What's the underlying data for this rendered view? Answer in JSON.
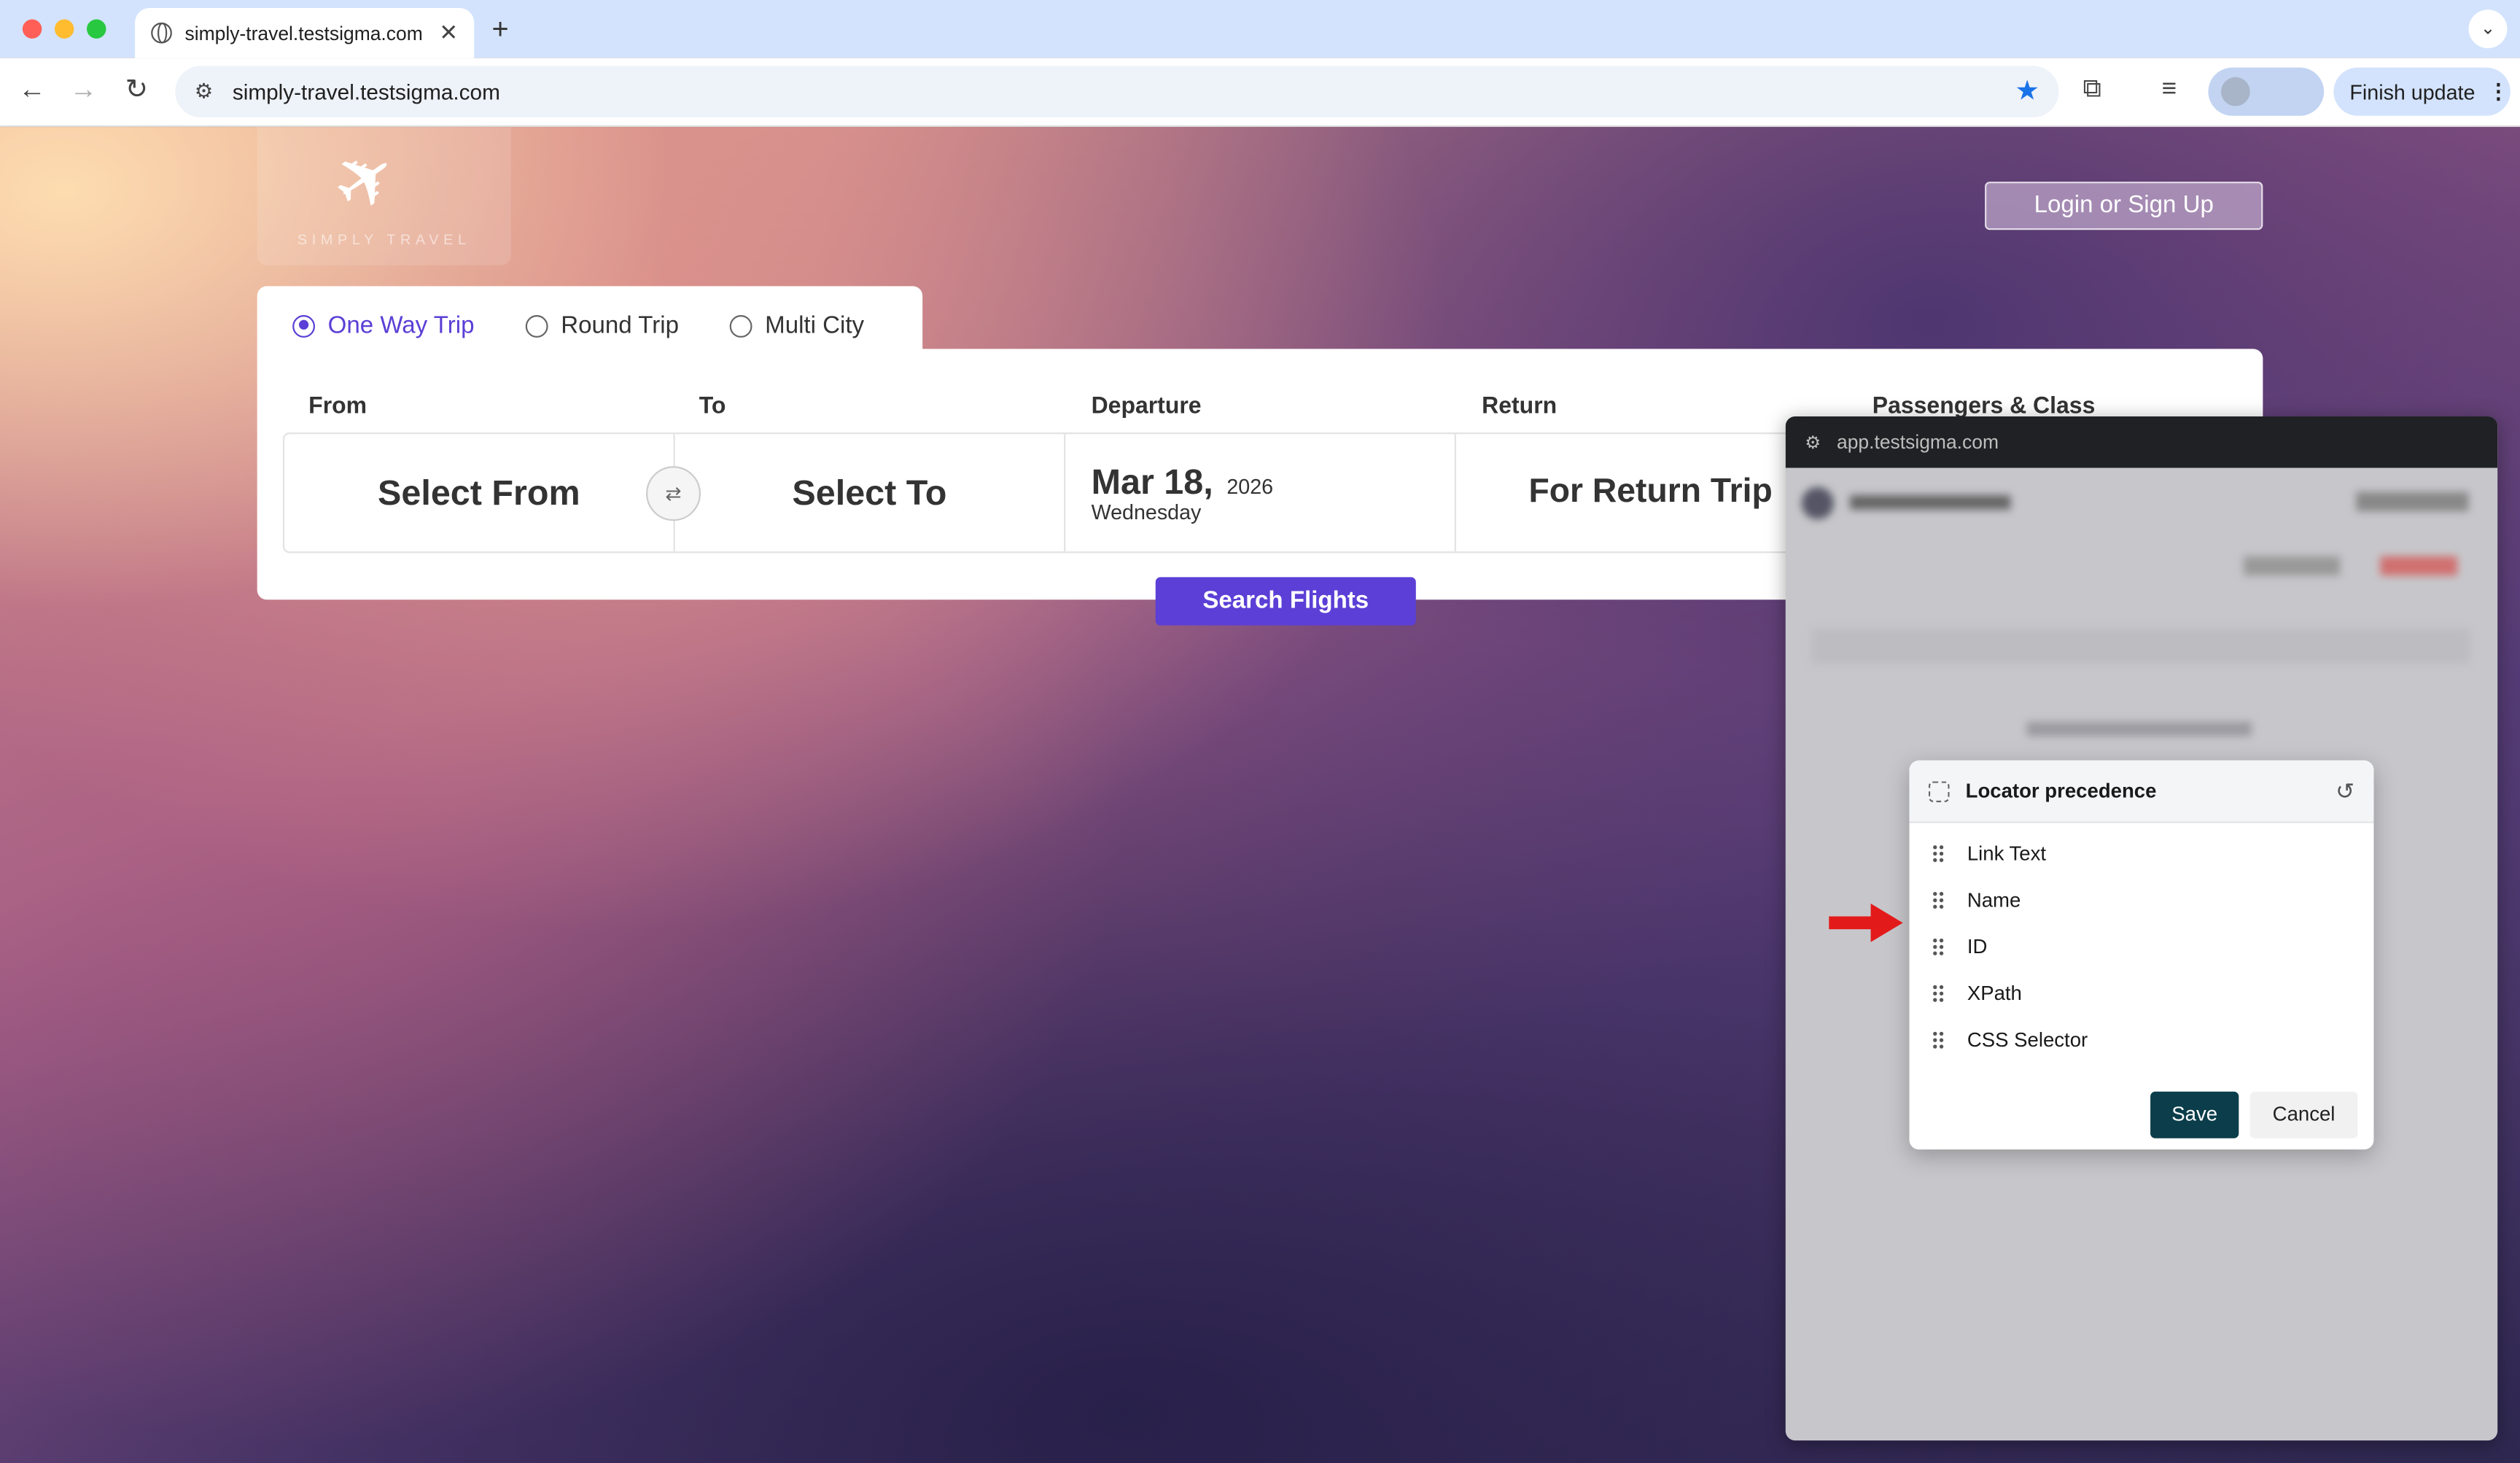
{
  "browser": {
    "tab_title": "simply-travel.testsigma.com",
    "url": "simply-travel.testsigma.com",
    "finish_update": "Finish update"
  },
  "site": {
    "logo_text": "SIMPLY TRAVEL",
    "login_label": "Login or Sign Up",
    "trip_types": [
      "One Way Trip",
      "Round Trip",
      "Multi City"
    ],
    "selected_trip": "One Way Trip",
    "labels": {
      "from": "From",
      "to": "To",
      "departure": "Departure",
      "return": "Return",
      "passengers": "Passengers & Class"
    },
    "from_value": "Select From",
    "to_value": "Select To",
    "departure": {
      "date": "Mar 18,",
      "year": "2026",
      "weekday": "Wednesday"
    },
    "return_value": "For Return Trip",
    "search_button": "Search Flights"
  },
  "extension": {
    "popup_url": "app.testsigma.com",
    "dialog": {
      "title": "Locator precedence",
      "items": [
        "Link Text",
        "Name",
        "ID",
        "XPath",
        "CSS Selector"
      ],
      "save": "Save",
      "cancel": "Cancel"
    }
  },
  "colors": {
    "accent": "#5b3fd6",
    "save_button": "#0b3d4a",
    "arrow": "#e31a1a"
  }
}
